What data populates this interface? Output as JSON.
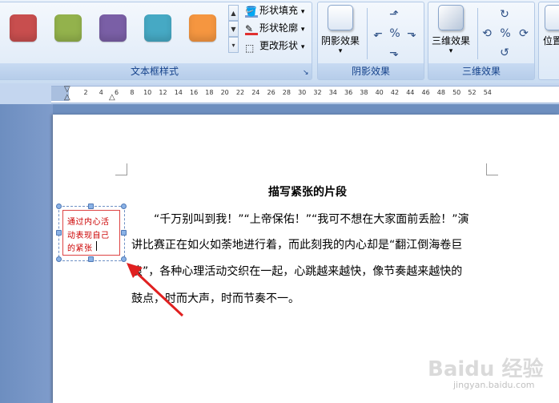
{
  "ribbon": {
    "textbox_styles": {
      "label": "文本框样式",
      "swatches": [
        "#c84e4e",
        "#93b24c",
        "#7a5fa6",
        "#46a9c4",
        "#f59640"
      ],
      "commands": {
        "fill": "形状填充",
        "outline": "形状轮廓",
        "change": "更改形状"
      }
    },
    "shadow": {
      "label": "阴影效果",
      "button": "阴影效果"
    },
    "threed": {
      "label": "三维效果",
      "button": "三维效果"
    },
    "position": {
      "button": "位置"
    }
  },
  "ruler": {
    "ticks": [
      "2",
      "4",
      "6",
      "8",
      "10",
      "12",
      "14",
      "16",
      "18",
      "20",
      "22",
      "24",
      "26",
      "28",
      "30",
      "32",
      "34",
      "36",
      "38",
      "40",
      "42",
      "44",
      "46",
      "48",
      "50",
      "52",
      "54"
    ]
  },
  "document": {
    "title": "描写紧张的片段",
    "lines": [
      "　　“千万别叫到我！”“上帝保佑！”“我可不想在大家面前丢脸！”演",
      "讲比赛正在如火如荼地进行着，而此刻我的内心却是“翻江倒海卷巨",
      "浪”，各种心理活动交织在一起，心跳越来越快，像节奏越来越快的",
      "鼓点，时而大声，时而节奏不一。"
    ]
  },
  "textbox": {
    "lines": [
      "通过内心活",
      "动表现自己",
      "的紧张"
    ]
  },
  "watermark": {
    "text": "Baidu 经验",
    "url": "jingyan.baidu.com"
  }
}
